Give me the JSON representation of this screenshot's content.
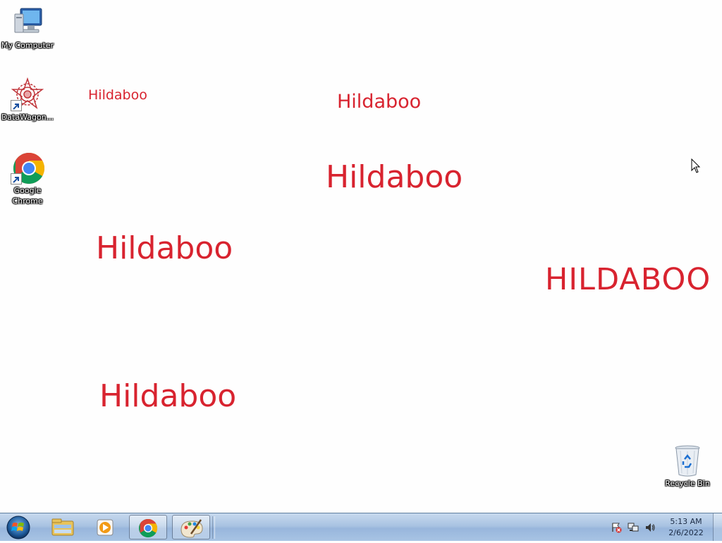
{
  "desktop": {
    "icons": [
      {
        "label": "My Computer",
        "icon": "computer-icon"
      },
      {
        "label": "DataWagon...",
        "icon": "datawagon-icon"
      },
      {
        "label": "Google Chrome",
        "icon": "chrome-icon"
      },
      {
        "label": "Recycle Bin",
        "icon": "recycle-bin-icon"
      }
    ],
    "wallpaper_text": [
      "Hildaboo",
      "Hildaboo",
      "Hildaboo",
      "Hildaboo",
      "HILDABOO",
      "Hildaboo"
    ],
    "text_color": "#d8232f"
  },
  "taskbar": {
    "start": "start-orb-icon",
    "pinned": [
      {
        "name": "windows-explorer-icon",
        "active": false
      },
      {
        "name": "media-player-icon",
        "active": false
      },
      {
        "name": "chrome-icon",
        "active": true
      },
      {
        "name": "paint-icon",
        "active": true
      }
    ],
    "tray": [
      "action-center-icon",
      "network-icon",
      "volume-icon"
    ],
    "clock": {
      "time": "5:13 AM",
      "date": "2/6/2022"
    }
  }
}
